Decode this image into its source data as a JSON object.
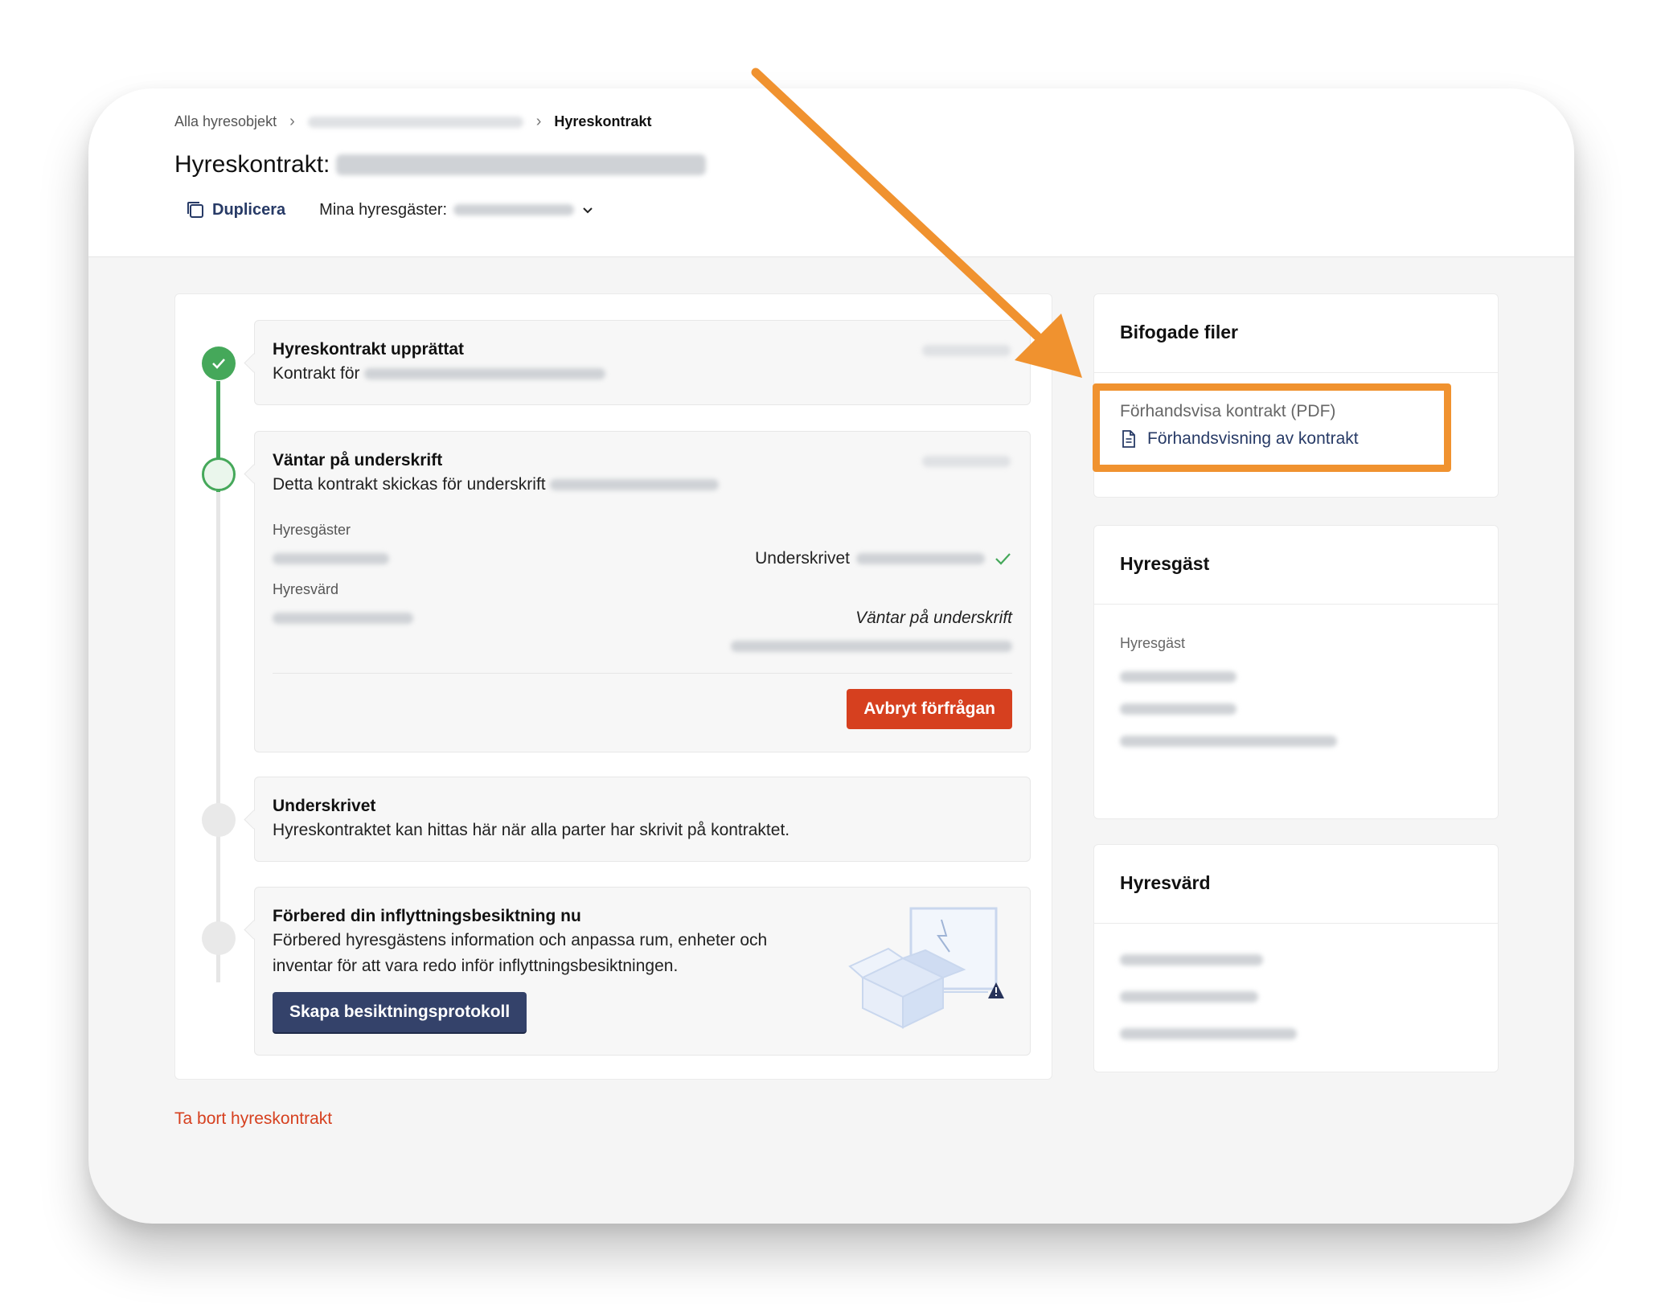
{
  "breadcrumb": {
    "root": "Alla hyresobjekt",
    "current": "Hyreskontrakt"
  },
  "header": {
    "title_prefix": "Hyreskontrakt:",
    "duplicate_label": "Duplicera",
    "tenants_label": "Mina hyresgäster:"
  },
  "timeline": [
    {
      "title": "Hyreskontrakt upprättat",
      "text": "Kontrakt för",
      "state": "done"
    },
    {
      "title": "Väntar på underskrift",
      "text": "Detta kontrakt skickas för underskrift",
      "state": "active",
      "tenants_label": "Hyresgäster",
      "tenant_status": "Underskrivet",
      "landlord_label": "Hyresvärd",
      "landlord_status": "Väntar på underskrift",
      "cancel_label": "Avbryt förfrågan"
    },
    {
      "title": "Underskrivet",
      "text": "Hyreskontraktet kan hittas här när alla parter har skrivit på kontraktet.",
      "state": "pending"
    },
    {
      "title": "Förbered din inflyttningsbesiktning nu",
      "text": "Förbered hyresgästens information och anpassa rum, enheter och inventar för att vara redo inför inflyttningsbesiktningen.",
      "state": "pending",
      "button_label": "Skapa besiktningsprotokoll"
    }
  ],
  "delete_label": "Ta bort hyreskontrakt",
  "files": {
    "heading": "Bifogade filer",
    "label": "Förhandsvisa kontrakt (PDF)",
    "link": "Förhandsvisning av kontrakt"
  },
  "tenant_card": {
    "heading": "Hyresgäst",
    "label": "Hyresgäst"
  },
  "landlord_card": {
    "heading": "Hyresvärd"
  },
  "colors": {
    "accent_green": "#45a85a",
    "danger": "#d6401f",
    "primary": "#34426a",
    "link": "#273a66",
    "annotation_orange": "#f0922f"
  }
}
